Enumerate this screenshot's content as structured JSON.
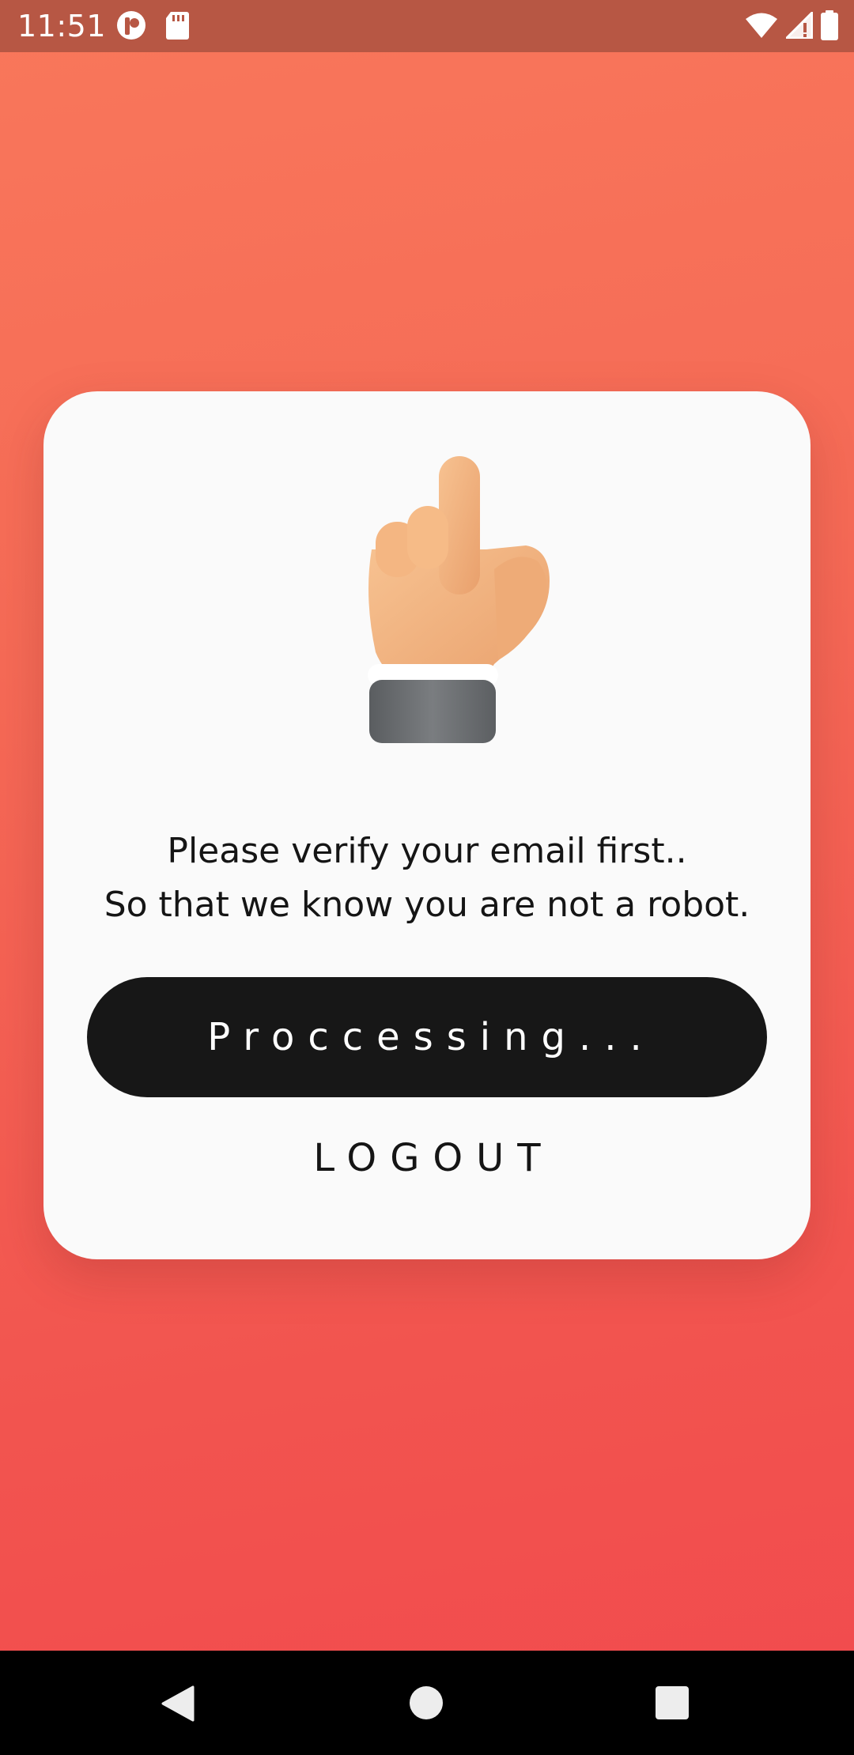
{
  "status_bar": {
    "time": "11:51",
    "left_icons": [
      "notification-app-icon",
      "sd-card-icon"
    ],
    "right_icons": [
      "wifi-icon",
      "cellular-signal-icon",
      "battery-icon"
    ]
  },
  "card": {
    "illustration": "pointing-hand-icon",
    "message_line1": "Please verify your email first..",
    "message_line2": "So that we know you are not a robot.",
    "processing_label": "Proccessing...",
    "logout_label": "LOGOUT"
  },
  "nav_bar": {
    "icons": [
      "back-icon",
      "home-icon",
      "recents-icon"
    ]
  },
  "colors": {
    "background_top": "#f9775b",
    "background_bottom": "#f14a4d",
    "status_bar": "#b75744",
    "card": "#fafafa",
    "button": "#171717"
  }
}
